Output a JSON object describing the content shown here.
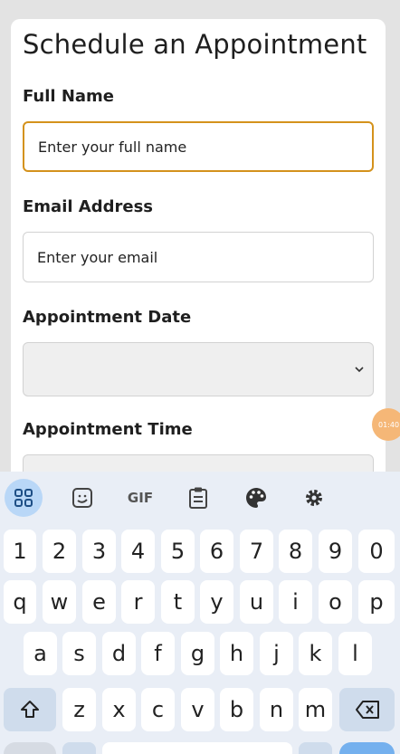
{
  "form": {
    "title": "Schedule an Appointment",
    "full_name_label": "Full Name",
    "full_name_placeholder": "Enter your full name",
    "email_label": "Email Address",
    "email_placeholder": "Enter your email",
    "date_label": "Appointment Date",
    "date_value": "",
    "time_label": "Appointment Time"
  },
  "overlay": {
    "bubble_text": "01:40"
  },
  "keyboard": {
    "toolbar": [
      "apps-icon",
      "sticker-icon",
      "gif-icon",
      "clipboard-icon",
      "palette-icon",
      "gear-icon"
    ],
    "gif_label": "GIF",
    "numbers": [
      "1",
      "2",
      "3",
      "4",
      "5",
      "6",
      "7",
      "8",
      "9",
      "0"
    ],
    "row1": [
      "q",
      "w",
      "e",
      "r",
      "t",
      "y",
      "u",
      "i",
      "o",
      "p"
    ],
    "row2": [
      "a",
      "s",
      "d",
      "f",
      "g",
      "h",
      "j",
      "k",
      "l"
    ],
    "row3": [
      "z",
      "x",
      "c",
      "v",
      "b",
      "n",
      "m"
    ]
  },
  "colors": {
    "focus_border": "#d4921c",
    "keyboard_bg": "#e9eef6",
    "active_toolbar": "#b9d7f7"
  }
}
